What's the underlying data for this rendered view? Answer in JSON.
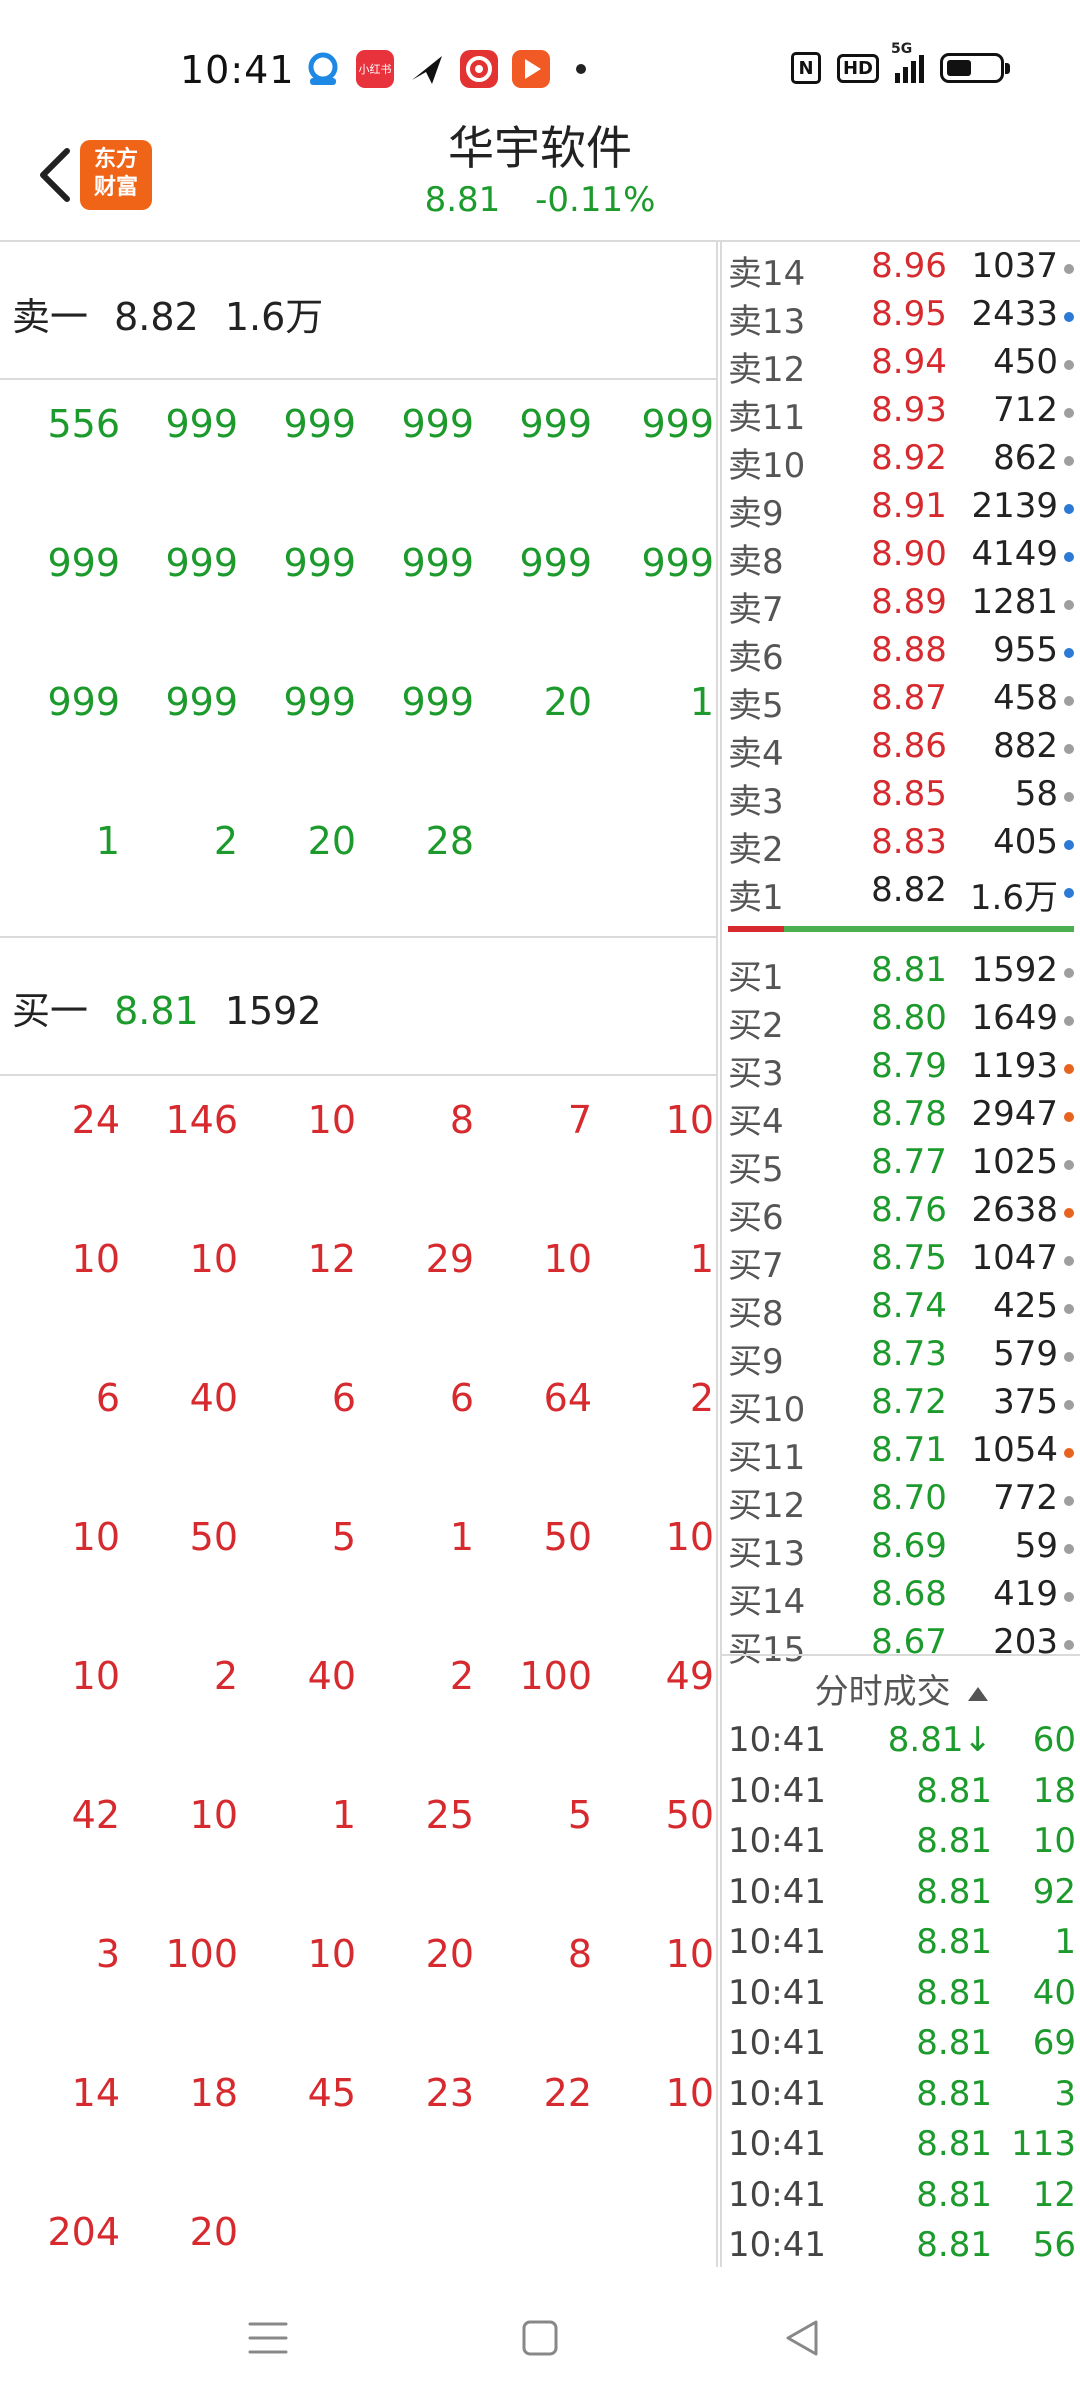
{
  "status": {
    "time": "10:41",
    "app_icons": [
      "cloud-icon",
      "xiaohongshu-icon",
      "plane-icon",
      "weibo-icon",
      "video-play-icon"
    ],
    "xiaohongshu_label": "小红书",
    "signal_label": "5G",
    "hd_label": "HD",
    "nfc_label": "N"
  },
  "header": {
    "logo_line1": "东方",
    "logo_line2": "财富",
    "title": "华宇软件",
    "price": "8.81",
    "change": "-0.11%"
  },
  "sell_side": {
    "label": "卖一",
    "price": "8.82",
    "volume": "1.6万",
    "orders": [
      "556",
      "999",
      "999",
      "999",
      "999",
      "999",
      "999",
      "999",
      "999",
      "999",
      "999",
      "999",
      "999",
      "999",
      "999",
      "999",
      "20",
      "1",
      "1",
      "2",
      "20",
      "28"
    ]
  },
  "buy_side": {
    "label": "买一",
    "price": "8.81",
    "volume": "1592",
    "orders": [
      "24",
      "146",
      "10",
      "8",
      "7",
      "10",
      "10",
      "10",
      "12",
      "29",
      "10",
      "1",
      "6",
      "40",
      "6",
      "6",
      "64",
      "2",
      "10",
      "50",
      "5",
      "1",
      "50",
      "10",
      "10",
      "2",
      "40",
      "2",
      "100",
      "49",
      "42",
      "10",
      "1",
      "25",
      "5",
      "50",
      "3",
      "100",
      "10",
      "20",
      "8",
      "10",
      "14",
      "18",
      "45",
      "23",
      "22",
      "10",
      "204",
      "20"
    ]
  },
  "order_book": {
    "asks": [
      {
        "label": "卖14",
        "price": "8.96",
        "vol": "1037",
        "dot": "#9e9e9e"
      },
      {
        "label": "卖13",
        "price": "8.95",
        "vol": "2433",
        "dot": "#2a7ad6"
      },
      {
        "label": "卖12",
        "price": "8.94",
        "vol": "450",
        "dot": "#9e9e9e"
      },
      {
        "label": "卖11",
        "price": "8.93",
        "vol": "712",
        "dot": "#9e9e9e"
      },
      {
        "label": "卖10",
        "price": "8.92",
        "vol": "862",
        "dot": "#9e9e9e"
      },
      {
        "label": "卖9",
        "price": "8.91",
        "vol": "2139",
        "dot": "#2a7ad6"
      },
      {
        "label": "卖8",
        "price": "8.90",
        "vol": "4149",
        "dot": "#2a7ad6"
      },
      {
        "label": "卖7",
        "price": "8.89",
        "vol": "1281",
        "dot": "#9e9e9e"
      },
      {
        "label": "卖6",
        "price": "8.88",
        "vol": "955",
        "dot": "#2a7ad6"
      },
      {
        "label": "卖5",
        "price": "8.87",
        "vol": "458",
        "dot": "#9e9e9e"
      },
      {
        "label": "卖4",
        "price": "8.86",
        "vol": "882",
        "dot": "#9e9e9e"
      },
      {
        "label": "卖3",
        "price": "8.85",
        "vol": "58",
        "dot": "#9e9e9e"
      },
      {
        "label": "卖2",
        "price": "8.83",
        "vol": "405",
        "dot": "#2a7ad6"
      },
      {
        "label": "卖1",
        "price": "8.82",
        "vol": "1.6万",
        "dot": "#2a7ad6"
      }
    ],
    "bids": [
      {
        "label": "买1",
        "price": "8.81",
        "vol": "1592",
        "dot": "#9e9e9e"
      },
      {
        "label": "买2",
        "price": "8.80",
        "vol": "1649",
        "dot": "#9e9e9e"
      },
      {
        "label": "买3",
        "price": "8.79",
        "vol": "1193",
        "dot": "#e8641e"
      },
      {
        "label": "买4",
        "price": "8.78",
        "vol": "2947",
        "dot": "#e8641e"
      },
      {
        "label": "买5",
        "price": "8.77",
        "vol": "1025",
        "dot": "#9e9e9e"
      },
      {
        "label": "买6",
        "price": "8.76",
        "vol": "2638",
        "dot": "#e8641e"
      },
      {
        "label": "买7",
        "price": "8.75",
        "vol": "1047",
        "dot": "#9e9e9e"
      },
      {
        "label": "买8",
        "price": "8.74",
        "vol": "425",
        "dot": "#9e9e9e"
      },
      {
        "label": "买9",
        "price": "8.73",
        "vol": "579",
        "dot": "#9e9e9e"
      },
      {
        "label": "买10",
        "price": "8.72",
        "vol": "375",
        "dot": "#9e9e9e"
      },
      {
        "label": "买11",
        "price": "8.71",
        "vol": "1054",
        "dot": "#e8641e"
      },
      {
        "label": "买12",
        "price": "8.70",
        "vol": "772",
        "dot": "#9e9e9e"
      },
      {
        "label": "买13",
        "price": "8.69",
        "vol": "59",
        "dot": "#9e9e9e"
      },
      {
        "label": "买14",
        "price": "8.68",
        "vol": "419",
        "dot": "#9e9e9e"
      },
      {
        "label": "买15",
        "price": "8.67",
        "vol": "203",
        "dot": "#9e9e9e"
      }
    ]
  },
  "ticks": {
    "header": "分时成交",
    "header_icon": "triangle-up-icon",
    "rows": [
      {
        "time": "10:41",
        "price": "8.81↓",
        "vol": "60"
      },
      {
        "time": "10:41",
        "price": "8.81",
        "vol": "18"
      },
      {
        "time": "10:41",
        "price": "8.81",
        "vol": "10"
      },
      {
        "time": "10:41",
        "price": "8.81",
        "vol": "92"
      },
      {
        "time": "10:41",
        "price": "8.81",
        "vol": "1"
      },
      {
        "time": "10:41",
        "price": "8.81",
        "vol": "40"
      },
      {
        "time": "10:41",
        "price": "8.81",
        "vol": "69"
      },
      {
        "time": "10:41",
        "price": "8.81",
        "vol": "3"
      },
      {
        "time": "10:41",
        "price": "8.81",
        "vol": "113"
      },
      {
        "time": "10:41",
        "price": "8.81",
        "vol": "12"
      },
      {
        "time": "10:41",
        "price": "8.81",
        "vol": "56"
      }
    ]
  },
  "colors": {
    "up": "#d62a2f",
    "down": "#1c9a2c",
    "brand": "#f06418"
  },
  "nav": [
    "menu-icon",
    "home-square-icon",
    "back-triangle-icon"
  ]
}
